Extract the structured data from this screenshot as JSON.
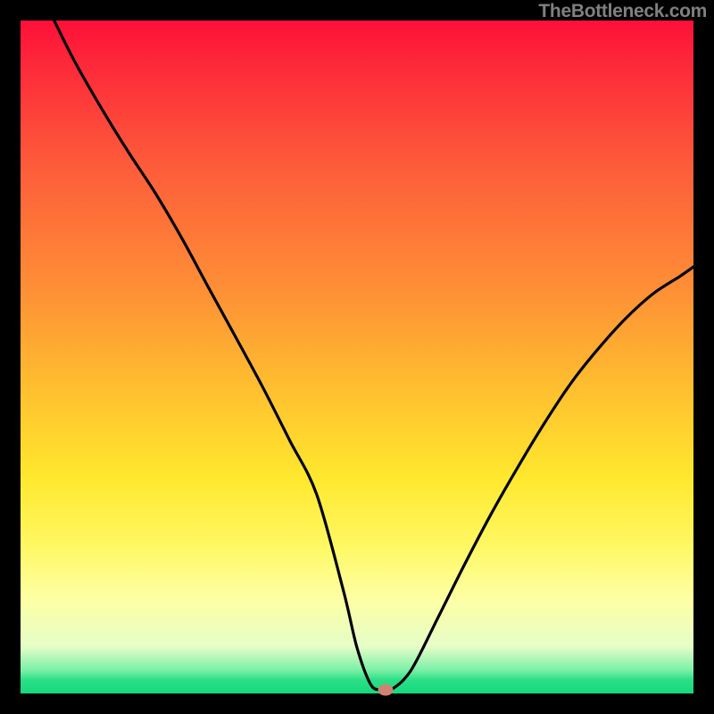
{
  "attribution": "TheBottleneck.com",
  "colors": {
    "frame": "#000000",
    "curve": "#000000",
    "gradient_top": "#fe1038",
    "gradient_bottom": "#15d87d",
    "min_marker": "#cf8371",
    "attribution_text": "#808080"
  },
  "chart_data": {
    "type": "line",
    "title": "",
    "xlabel": "",
    "ylabel": "",
    "xlim": [
      0,
      100
    ],
    "ylim": [
      0,
      100
    ],
    "series": [
      {
        "name": "bottleneck-curve",
        "x": [
          5,
          8,
          12,
          16,
          20,
          24,
          28,
          32,
          36,
          40,
          44,
          48,
          50,
          52,
          53.5,
          55,
          58,
          62,
          66,
          70,
          74,
          78,
          82,
          86,
          90,
          94,
          98,
          100
        ],
        "y": [
          100,
          94,
          87,
          80.5,
          74.4,
          67.6,
          60.2,
          52.9,
          45.5,
          37.6,
          29.6,
          15.2,
          6.8,
          1.4,
          0.5,
          0.5,
          3.4,
          11.2,
          19.2,
          26.8,
          33.8,
          40.4,
          46.4,
          51.4,
          55.8,
          59.4,
          62.0,
          63.4
        ]
      }
    ],
    "min_marker": {
      "x": 54.3,
      "y": 0.5
    },
    "annotations": [],
    "legend": null,
    "grid": false
  }
}
